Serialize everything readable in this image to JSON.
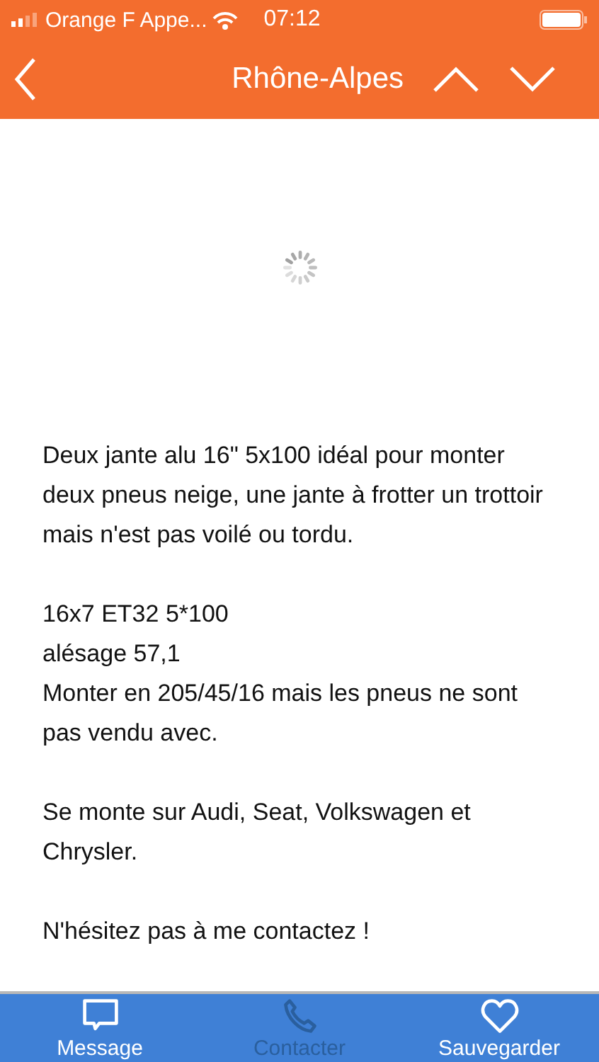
{
  "status_bar": {
    "carrier": "Orange F Appe...",
    "time": "07:12"
  },
  "nav": {
    "title": "Rhône-Alpes"
  },
  "content": {
    "loading": true,
    "paragraphs": [
      "Deux jante alu 16\" 5x100 idéal pour monter deux pneus neige, une jante à frotter un trottoir mais n'est pas voilé ou tordu.",
      "16x7 ET32 5*100\nalésage 57,1\nMonter en 205/45/16 mais les pneus ne sont pas vendu avec.",
      "Se monte sur Audi, Seat, Volkswagen et Chrysler.",
      "N'hésitez pas à me contactez !"
    ]
  },
  "tab_bar": [
    {
      "kind": "message",
      "label": "Message",
      "disabled": false
    },
    {
      "kind": "phone",
      "label": "Contacter",
      "disabled": true
    },
    {
      "kind": "heart",
      "label": "Sauvegarder",
      "disabled": false
    }
  ]
}
